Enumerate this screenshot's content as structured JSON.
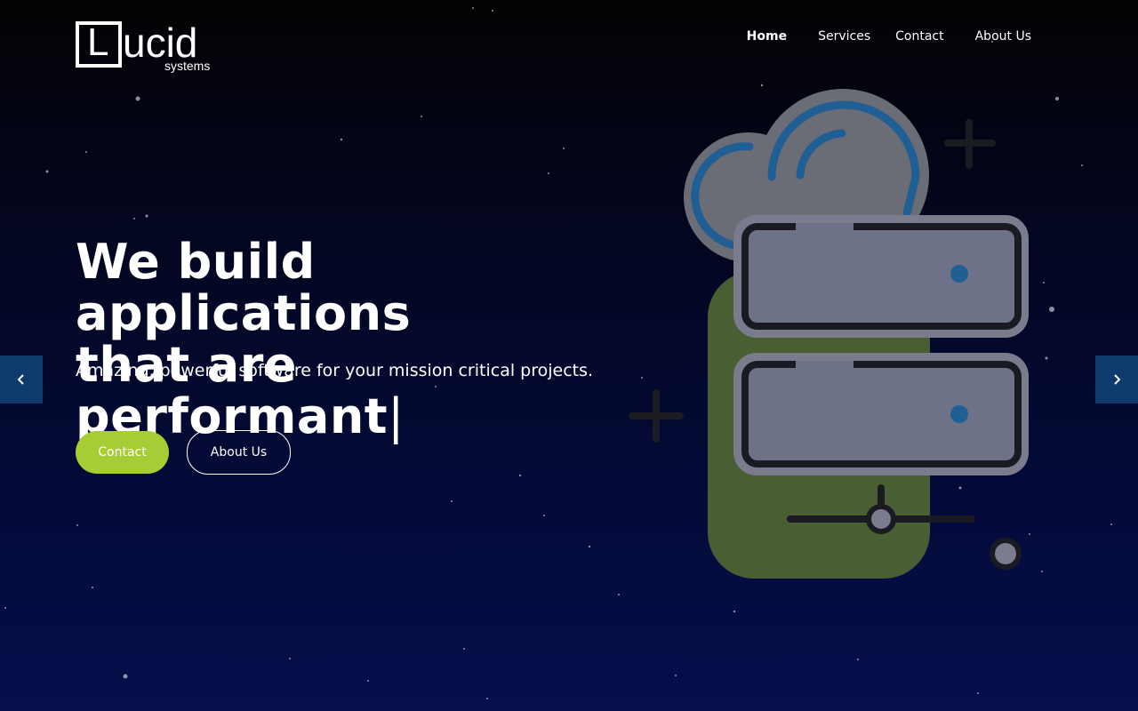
{
  "brand": {
    "logo_letter": "L",
    "logo_word": "ucid",
    "logo_subtitle": "systems"
  },
  "nav": {
    "items": [
      {
        "label": "Home",
        "active": true
      },
      {
        "label": "Services"
      },
      {
        "label": "Contact"
      },
      {
        "label": "About Us"
      }
    ]
  },
  "hero": {
    "headline_line1": "We build applications",
    "headline_line2": "that are performant",
    "cursor": "|",
    "subline": "Amazing, powerful software for your mission critical projects.",
    "buttons": {
      "contact": "Contact",
      "about": "About Us"
    }
  },
  "slider": {
    "prev_icon": "chevron-left-icon",
    "next_icon": "chevron-right-icon"
  },
  "illustration": {
    "name": "cloud-server-illustration"
  },
  "colors": {
    "accent": "#a6cd35",
    "arrow_bg": "#0e3a6c",
    "background_top": "#030303",
    "background_bottom": "#060e4c"
  }
}
